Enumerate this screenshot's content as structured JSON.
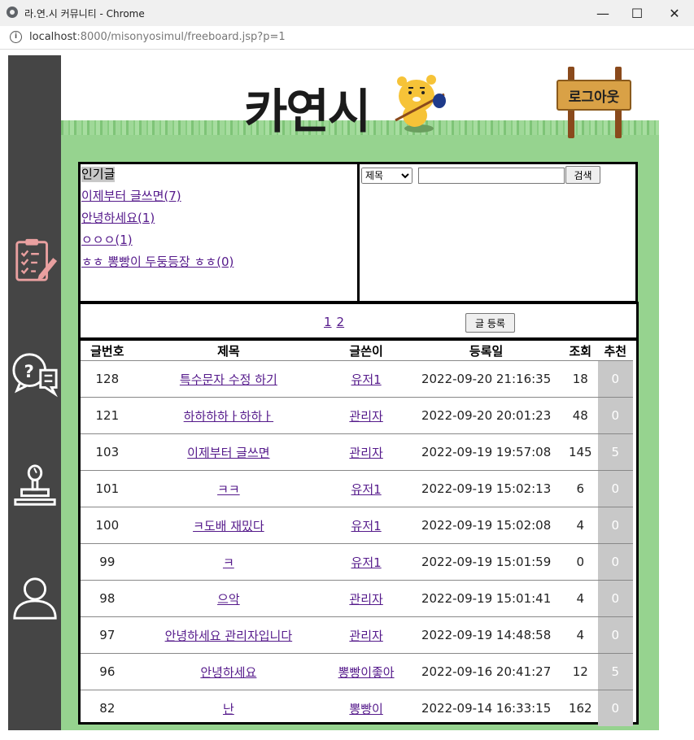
{
  "browser": {
    "window_title": "라.연.시 커뮤니티 - Chrome",
    "url_host": "localhost",
    "url_rest": ":8000/misonyosimul/freeboard.jsp?p=1"
  },
  "header": {
    "logo_text": "카연시",
    "logout_label": "로그아웃"
  },
  "popular": {
    "heading": "인기글",
    "items": [
      "이제부터 글쓰면(7)",
      "안녕하세요(1)",
      "ㅇㅇㅇ(1)",
      "ㅎㅎ 뽕빵이 두둥등장 ㅎㅎ(0)"
    ]
  },
  "search": {
    "select_value": "제목",
    "input_value": "",
    "button_label": "검색"
  },
  "pager": {
    "pages": [
      "1",
      "2"
    ],
    "register_label": "글 등록"
  },
  "table": {
    "headers": [
      "글번호",
      "제목",
      "글쓴이",
      "등록일",
      "조회",
      "추천"
    ],
    "rows": [
      {
        "no": "128",
        "title": "특수문자 수정 하기",
        "author": "유저1",
        "date": "2022-09-20 21:16:35",
        "views": "18",
        "rec": "0"
      },
      {
        "no": "121",
        "title": "하하하하ㅏ하하ㅏ",
        "author": "관리자",
        "date": "2022-09-20 20:01:23",
        "views": "48",
        "rec": "0"
      },
      {
        "no": "103",
        "title": "이제부터 글쓰면",
        "author": "관리자",
        "date": "2022-09-19 19:57:08",
        "views": "145",
        "rec": "5"
      },
      {
        "no": "101",
        "title": "ㅋㅋ",
        "author": "유저1",
        "date": "2022-09-19 15:02:13",
        "views": "6",
        "rec": "0"
      },
      {
        "no": "100",
        "title": "ㅋ도배 재밌다",
        "author": "유저1",
        "date": "2022-09-19 15:02:08",
        "views": "4",
        "rec": "0"
      },
      {
        "no": "99",
        "title": "ㅋ",
        "author": "유저1",
        "date": "2022-09-19 15:01:59",
        "views": "0",
        "rec": "0"
      },
      {
        "no": "98",
        "title": "으악",
        "author": "관리자",
        "date": "2022-09-19 15:01:41",
        "views": "4",
        "rec": "0"
      },
      {
        "no": "97",
        "title": "안녕하세요 관리자입니다",
        "author": "관리자",
        "date": "2022-09-19 14:48:58",
        "views": "4",
        "rec": "0"
      },
      {
        "no": "96",
        "title": "안녕하세요",
        "author": "뽕빵이좋아",
        "date": "2022-09-16 20:41:27",
        "views": "12",
        "rec": "5"
      },
      {
        "no": "82",
        "title": "난",
        "author": "뽕빵이",
        "date": "2022-09-14 16:33:15",
        "views": "162",
        "rec": "0"
      }
    ]
  }
}
